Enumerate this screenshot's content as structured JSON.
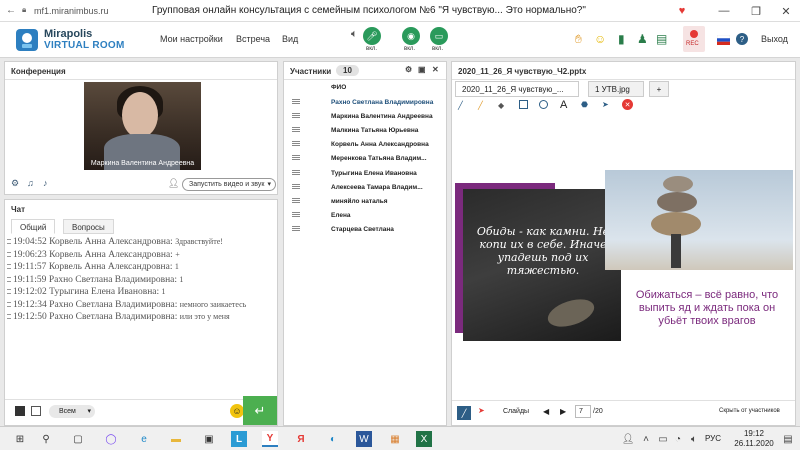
{
  "window": {
    "url": "mf1.miranimbus.ru",
    "title": "Групповая онлайн консультация с семейным психологом №6 \"Я чувствую... Это нормально?\""
  },
  "header": {
    "logo_line1": "Mirapolis",
    "logo_line2": "VIRTUAL ROOM",
    "menu": [
      "Мои настройки",
      "Встреча",
      "Вид"
    ],
    "toggles": [
      "вкл.",
      "вкл.",
      "вкл."
    ],
    "rec": "REC",
    "logout": "Выход"
  },
  "conference": {
    "title": "Конференция",
    "video_caption": "Маркина Валентина  Андреевна",
    "start_video": "Запустить видео и звук"
  },
  "chat": {
    "title": "Чат",
    "tabs": [
      "Общий",
      "Вопросы"
    ],
    "messages": [
      {
        "time": "19:04:52",
        "author": "Корвель Анна  Александровна:",
        "text": "Здравствуйте!"
      },
      {
        "time": "19:06:23",
        "author": "Корвель Анна  Александровна:",
        "text": "+"
      },
      {
        "time": "19:11:57",
        "author": "Корвель Анна  Александровна:",
        "text": "1"
      },
      {
        "time": "19:11:59",
        "author": "Рахно Светлана  Владимировна:",
        "text": "1"
      },
      {
        "time": "19:12:02",
        "author": "Турыгина  Елена  Ивановна:",
        "text": "1"
      },
      {
        "time": "19:12:34",
        "author": "Рахно Светлана  Владимировна:",
        "text": "немного заикаетесь"
      },
      {
        "time": "19:12:50",
        "author": "Рахно Светлана  Владимировна:",
        "text": "или это у меня"
      }
    ],
    "recipient": "Всем"
  },
  "participants": {
    "title": "Участники",
    "count": "10",
    "column": "ФИО",
    "list": [
      "Рахно Светлана  Владимировна",
      "Маркина Валентина  Андреевна",
      "Малкина Татьяна  Юрьевна",
      "Корвель Анна  Александровна",
      "Меренкова  Татьяна  Владим...",
      "Турыгина  Елена  Ивановна",
      "Алексеева  Тамара  Владим...",
      "миняйло  наталья",
      "Елена",
      "Старцева  Светлана"
    ]
  },
  "presentation": {
    "tabs": [
      "2020_11_26_Я чувствую_...",
      "1 УТВ.jpg",
      "+"
    ],
    "title": "2020_11_26_Я чувствую_Ч2.pptx",
    "slide_text_left": "Обиды - как камни. Не копи их в себе. Иначе упадешь под их тяжестью.",
    "slide_text_right": "Обижаться – всё равно, что выпить яд и ждать пока он убьёт твоих врагов",
    "slides_label": "Слайды",
    "current_slide": "7",
    "total_slides": "/20",
    "hide_label": "Скрыть от участников"
  },
  "taskbar": {
    "lang": "РУС",
    "time": "19:12",
    "date": "26.11.2020"
  },
  "colors": {
    "accent_green": "#4caf50",
    "brand_blue": "#2d7fc0",
    "slide_purple": "#7b2a7d"
  }
}
